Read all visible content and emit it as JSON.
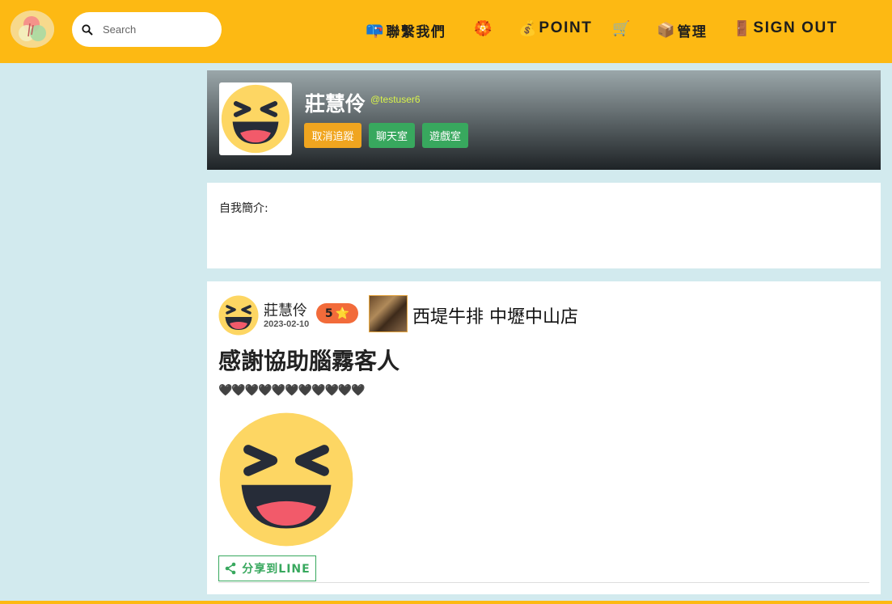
{
  "search": {
    "placeholder": "Search"
  },
  "nav": {
    "contact": {
      "icon": "📪",
      "label": "聯繫我們"
    },
    "badge": {
      "icon": "🏵️"
    },
    "point": {
      "icon": "💰",
      "label": "POINT"
    },
    "cart": {
      "icon": "🛒"
    },
    "manage": {
      "icon": "📦",
      "label": "管理"
    },
    "signout": {
      "icon": "🚪",
      "label": "SIGN OUT"
    }
  },
  "profile": {
    "name": "莊慧伶",
    "handle": "@testuser6",
    "unfollow_label": "取消追蹤",
    "chat_label": "聊天室",
    "game_label": "遊戲室"
  },
  "bio": {
    "label": "自我簡介:"
  },
  "post": {
    "author": "莊慧伶",
    "date": "2023-02-10",
    "rating": "5",
    "rating_icon": "⭐",
    "shop_name": "西堤牛排 中壢中山店",
    "title": "感謝協助腦霧客人",
    "hearts": "🖤🖤🖤🖤🖤🖤🖤🖤🖤🖤🖤",
    "share_label": "分享到LINE"
  },
  "colors": {
    "topbar": "#fdb913",
    "background": "#d2eaee",
    "green": "#38a85e",
    "orange": "#f0a51f"
  }
}
